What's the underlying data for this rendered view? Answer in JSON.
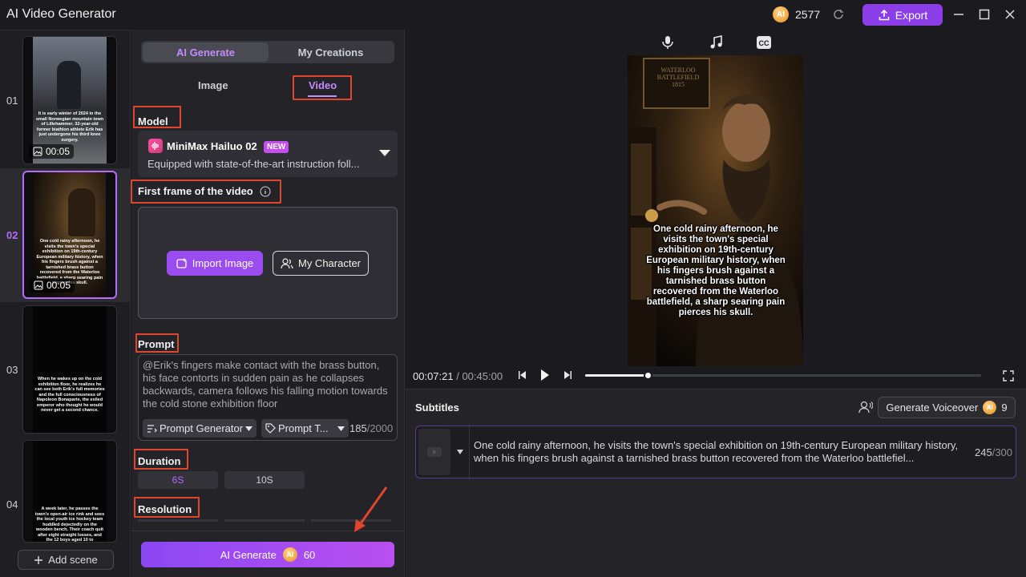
{
  "app": {
    "title": "AI Video Generator",
    "credits": "2577",
    "export_label": "Export"
  },
  "scenes": [
    {
      "num": "01",
      "duration": "00:05",
      "caption": "It is early winter of 2024 in the small Norwegian mountain town of Lillehammer. 32-year-old former biathlon athlete Erik has just undergone his third knee surgery."
    },
    {
      "num": "02",
      "duration": "00:05",
      "caption": "One cold rainy afternoon, he visits the town's special exhibition on 19th-century European military history, when his fingers brush against a tarnished brass button recovered from the Waterloo battlefield, a sharp searing pain pierces his skull."
    },
    {
      "num": "03",
      "duration": "",
      "caption": "When he wakes up on the cold exhibition floor, he realizes he can see both Erik's full memories and the full consciousness of Napoleon Bonaparte, the exiled emperor who thought he would never get a second chance."
    },
    {
      "num": "04",
      "duration": "",
      "caption": "A week later, he passes the town's open-air ice rink and sees the local youth ice hockey team huddled dejectedly on the wooden bench. Their coach quit after eight straight losses, and the 12 boys aged 10 to"
    }
  ],
  "add_scene_label": "Add scene",
  "panel": {
    "tabs": [
      "AI Generate",
      "My Creations"
    ],
    "subtabs": [
      "Image",
      "Video"
    ],
    "model_label": "Model",
    "model_name": "MiniMax Hailuo 02",
    "model_badge": "NEW",
    "model_desc": "Equipped with state-of-the-art instruction foll...",
    "first_frame_label": "First frame of the video",
    "import_label": "Import Image",
    "character_label": "My Character",
    "prompt_label": "Prompt",
    "prompt_text": "@Erik's fingers make contact with the brass button, his face contorts in sudden pain as he collapses backwards, camera follows his falling motion towards the cold stone exhibition floor",
    "prompt_generator": "Prompt Generator",
    "prompt_template": "Prompt T...",
    "prompt_count": "185",
    "prompt_max": "/2000",
    "duration_label": "Duration",
    "durations": [
      "6S",
      "10S"
    ],
    "resolution_label": "Resolution",
    "generate_label": "AI Generate",
    "generate_cost": "60"
  },
  "preview": {
    "caption": "One cold rainy afternoon, he visits the town's special exhibition on 19th-century European military history, when his fingers brush against a tarnished brass button recovered from the Waterloo battlefield, a sharp searing pain pierces his skull.",
    "sign_text": "WATERLOO BATTLEFIELD 1815",
    "time_current": "00:07:21",
    "time_total": " / 00:45:00",
    "progress": 0.16
  },
  "subtitles": {
    "title": "Subtitles",
    "voiceover_label": "Generate Voiceover",
    "voiceover_cost": "9",
    "text": "One cold rainy afternoon, he visits the town's special exhibition on 19th-century European military history, when his fingers brush against a tarnished brass button recovered from the Waterloo battlefiel...",
    "count": "245",
    "max": "/300"
  },
  "colors": {
    "accent": "#9a4cf0",
    "annotation": "#e0452f",
    "active_tab": "#c48bff"
  }
}
